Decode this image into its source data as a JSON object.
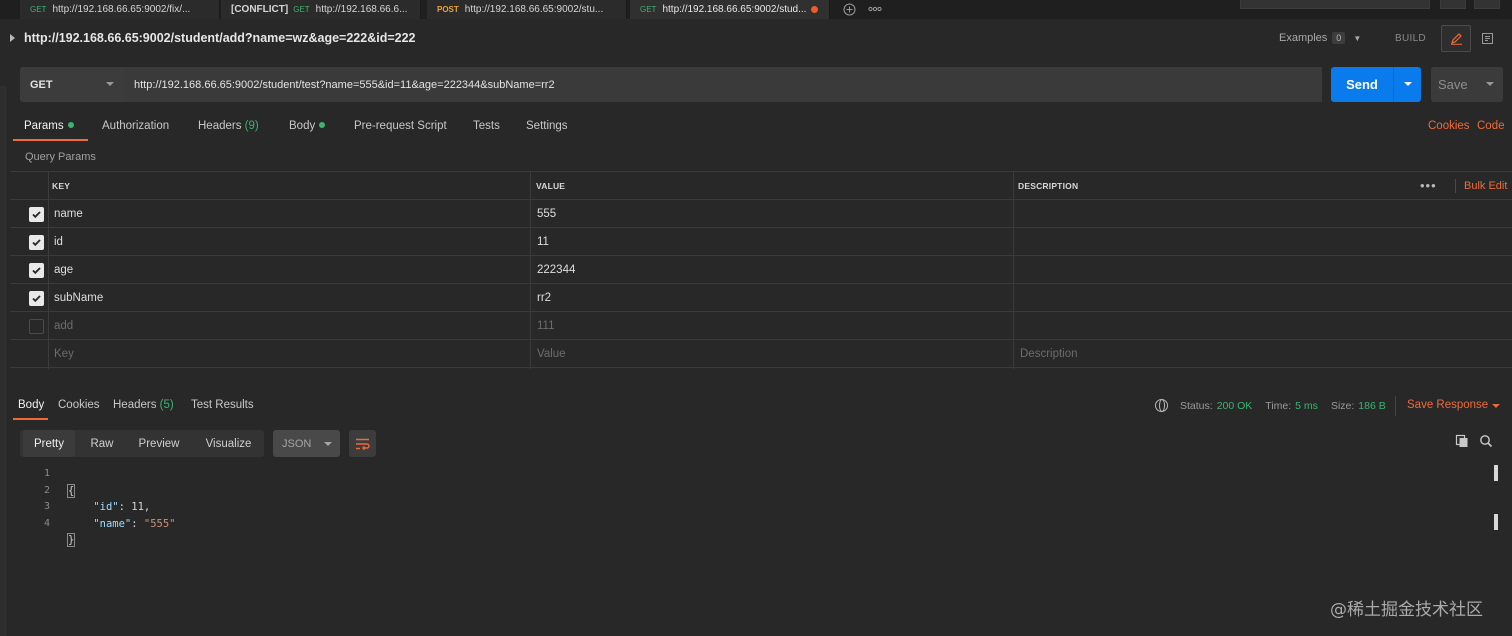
{
  "tabs": [
    {
      "method": "GET",
      "url": "http://192.168.66.65:9002/fix/..."
    },
    {
      "prefix": "[CONFLICT]",
      "method": "GET",
      "url": "http://192.168.66.6..."
    },
    {
      "method": "POST",
      "url": "http://192.168.66.65:9002/stu..."
    },
    {
      "method": "GET",
      "url": "http://192.168.66.65:9002/stud...",
      "unsaved": true
    }
  ],
  "request_title": "http://192.168.66.65:9002/student/add?name=wz&age=222&id=222",
  "examples": {
    "label": "Examples",
    "count": "0"
  },
  "build_label": "BUILD",
  "url_bar": {
    "method": "GET",
    "url": "http://192.168.66.65:9002/student/test?name=555&id=11&age=222344&subName=rr2",
    "send_label": "Send",
    "save_label": "Save"
  },
  "request_tabs": [
    {
      "label": "Params"
    },
    {
      "label": "Authorization"
    },
    {
      "label": "Headers",
      "count": "(9)"
    },
    {
      "label": "Body"
    },
    {
      "label": "Pre-request Script"
    },
    {
      "label": "Tests"
    },
    {
      "label": "Settings"
    }
  ],
  "links": {
    "cookies": "Cookies",
    "code": "Code"
  },
  "query_params_label": "Query Params",
  "params_table": {
    "headers": {
      "key": "KEY",
      "value": "VALUE",
      "description": "DESCRIPTION"
    },
    "bulk_edit": "Bulk Edit",
    "rows": [
      {
        "key": "name",
        "value": "555",
        "description": "",
        "checked": true
      },
      {
        "key": "id",
        "value": "11",
        "description": "",
        "checked": true
      },
      {
        "key": "age",
        "value": "222344",
        "description": "",
        "checked": true
      },
      {
        "key": "subName",
        "value": "rr2",
        "description": "",
        "checked": true
      },
      {
        "key": "add",
        "value": "111",
        "description": "",
        "checked": false
      }
    ],
    "placeholders": {
      "key": "Key",
      "value": "Value",
      "description": "Description"
    }
  },
  "response_tabs": [
    {
      "label": "Body"
    },
    {
      "label": "Cookies"
    },
    {
      "label": "Headers",
      "count": "(5)"
    },
    {
      "label": "Test Results"
    }
  ],
  "response_status": {
    "status_label": "Status:",
    "status_value": "200 OK",
    "time_label": "Time:",
    "time_value": "5 ms",
    "size_label": "Size:",
    "size_value": "186 B",
    "save_response": "Save Response"
  },
  "view_modes": [
    "Pretty",
    "Raw",
    "Preview",
    "Visualize"
  ],
  "format": "JSON",
  "response_body": {
    "line_numbers": [
      "1",
      "2",
      "3",
      "4"
    ],
    "open_brace": "{",
    "close_brace": "}",
    "fields": [
      {
        "key": "\"id\"",
        "value": "11",
        "trailing": ","
      },
      {
        "key": "\"name\"",
        "value": "\"555\"",
        "trailing": ""
      }
    ]
  },
  "watermark": "@稀土掘金技术社区",
  "colors": {
    "accent": "#ef6a3b",
    "send": "#097bed",
    "ok": "#3cb371"
  }
}
